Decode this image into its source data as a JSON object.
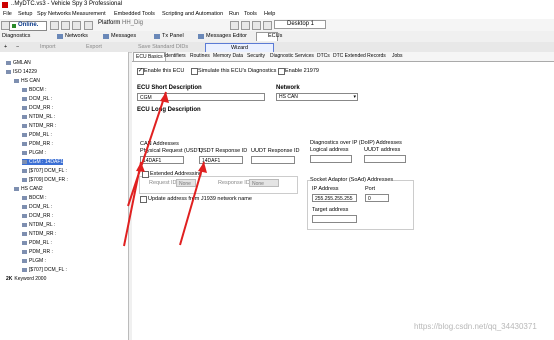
{
  "window": {
    "title": "..MyDTC.vs3 - Vehicle Spy 3 Professional"
  },
  "menu": [
    "File",
    "Setup",
    "Spy Networks",
    "Measurement",
    "Embedded Tools",
    "Scripting and Automation",
    "Run",
    "Tools",
    "Help"
  ],
  "toolbar": {
    "online_label": "Online.",
    "platform_label": "Platform",
    "platform_value": "HH_Dig",
    "desktop_tab": "Desktop 1"
  },
  "toolbar2": {
    "diagnostics": "Diagnostics",
    "networks": "Networks",
    "messages": "Messages",
    "tx_panel": "Tx Panel",
    "messages_editor": "Messages Editor",
    "ecus": "ECUs"
  },
  "toolbar3": {
    "add": "+",
    "remove": "−",
    "import": "Import",
    "export": "Export",
    "save_standard": "Save Standard DIDs",
    "wizard": "Wizard"
  },
  "tree": [
    "GMLAN",
    "ISO 14229",
    "HS CAN",
    "BDCM :",
    "DCM_RL :",
    "DCM_RR :",
    "NTDM_RL :",
    "NTDM_RR :",
    "PDM_RL :",
    "PDM_RR :",
    "PLGM :",
    "CGM : 14DAF1",
    "[$707] DCM_FL :",
    "[$709] DCM_FR :",
    "HS CAN2",
    "BDCM :",
    "DCM_RL :",
    "DCM_RR :",
    "NTDM_RL :",
    "NTDM_RR :",
    "PDM_RL :",
    "PDM_RR :",
    "PLGM :",
    "[$707] DCM_FL :",
    "2K",
    "Keyword 2000"
  ],
  "tabs": [
    "ECU Basics",
    "Identifiers",
    "Routines",
    "Memory Data",
    "Security",
    "Diagnostic Services",
    "DTCs",
    "DTC Extended Records",
    "Jobs"
  ],
  "form": {
    "enable_ecu": "Enable this ECU",
    "simulate_diag": "Simulate this ECU's Diagnostics",
    "enable_21979": "Enable 21979",
    "short_desc_label": "ECU Short Description",
    "short_desc_value": "CGM",
    "network_label": "Network",
    "network_value": "HS CAN",
    "long_desc_label": "ECU Long Description",
    "can_addresses_label": "CAN Addresses",
    "phys_req_label": "Physical Request  (USDT)",
    "phys_req_value": "14DAF1",
    "usdt_resp_label": "USDT Response ID",
    "usdt_resp_value": "14DAF1",
    "uudt_resp_label": "UUDT Response ID",
    "uudt_resp_value": "",
    "extended_addressing": "Extended Addressing",
    "request_id_label": "Request ID",
    "request_id_value": "None",
    "response_id_label": "Response ID",
    "response_id_value": "None",
    "update_addr": "Update address from J1939 network name",
    "doip_label": "Diagnostics over IP (DoIP) Addresses",
    "logical_addr_label": "Logical address",
    "uudt_addr_label": "UUDT address",
    "soad_label": "Socket Adaptor (SoAd) Addresses",
    "ip_label": "IP Address",
    "ip_value": "255.255.255.255",
    "port_label": "Port",
    "port_value": "0",
    "target_addr_label": "Target address"
  },
  "watermark": "https://blog.csdn.net/qq_34430371"
}
